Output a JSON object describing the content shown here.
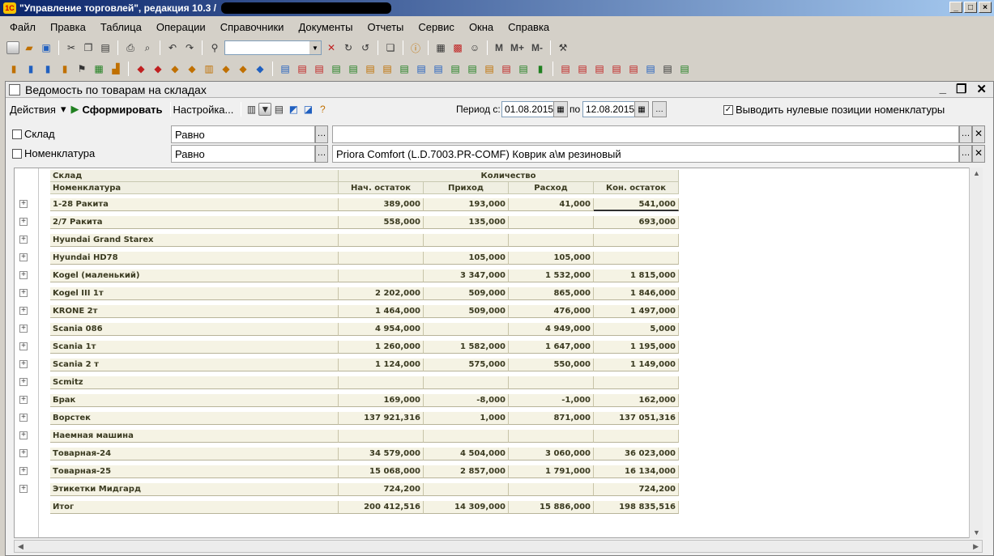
{
  "app": {
    "title": "\"Управление торговлей\", редакция 10.3 /",
    "logo": "1С"
  },
  "menu": [
    "Файл",
    "Правка",
    "Таблица",
    "Операции",
    "Справочники",
    "Документы",
    "Отчеты",
    "Сервис",
    "Окна",
    "Справка"
  ],
  "toolbar": {
    "m_label": "M",
    "mplus_label": "M+",
    "mminus_label": "M-"
  },
  "document": {
    "title": "Ведомость по товарам на складах",
    "actions_label": "Действия",
    "generate_label": "Сформировать",
    "settings_label": "Настройка...",
    "period_from_label": "Период с:",
    "period_from": "01.08.2015",
    "period_to_label": "по",
    "period_to": "12.08.2015",
    "zero_positions_label": "Выводить нулевые позиции номенклатуры",
    "zero_positions_checked": true
  },
  "filters": [
    {
      "label": "Склад",
      "checked": false,
      "comparison": "Равно",
      "value": ""
    },
    {
      "label": "Номенклатура",
      "checked": false,
      "comparison": "Равно",
      "value": "Priora Comfort (L.D.7003.PR-COMF) Коврик а\\м резиновый"
    }
  ],
  "report": {
    "header": {
      "col_sklad": "Склад",
      "col_nomen": "Номенклатура",
      "group_qty": "Количество",
      "col_start": "Нач. остаток",
      "col_in": "Приход",
      "col_out": "Расход",
      "col_end": "Кон. остаток"
    },
    "rows": [
      {
        "name": "1-28 Ракита",
        "start": "389,000",
        "in": "193,000",
        "out": "41,000",
        "end": "541,000"
      },
      {
        "name": "2/7 Ракита",
        "start": "558,000",
        "in": "135,000",
        "out": "",
        "end": "693,000"
      },
      {
        "name": "Hyundai Grand Starex",
        "start": "",
        "in": "",
        "out": "",
        "end": ""
      },
      {
        "name": "Hyundai HD78",
        "start": "",
        "in": "105,000",
        "out": "105,000",
        "end": ""
      },
      {
        "name": "Kogel (маленький)",
        "start": "",
        "in": "3 347,000",
        "out": "1 532,000",
        "end": "1 815,000"
      },
      {
        "name": "Kogel III  1т",
        "start": "2 202,000",
        "in": "509,000",
        "out": "865,000",
        "end": "1 846,000"
      },
      {
        "name": "KRONE 2т",
        "start": "1 464,000",
        "in": "509,000",
        "out": "476,000",
        "end": "1 497,000"
      },
      {
        "name": "Scania 086",
        "start": "4 954,000",
        "in": "",
        "out": "4 949,000",
        "end": "5,000"
      },
      {
        "name": "Scania 1т",
        "start": "1 260,000",
        "in": "1 582,000",
        "out": "1 647,000",
        "end": "1 195,000"
      },
      {
        "name": "Scania 2 т",
        "start": "1 124,000",
        "in": "575,000",
        "out": "550,000",
        "end": "1 149,000"
      },
      {
        "name": "Scmitz",
        "start": "",
        "in": "",
        "out": "",
        "end": ""
      },
      {
        "name": "Брак",
        "start": "169,000",
        "in": "-8,000",
        "out": "-1,000",
        "end": "162,000"
      },
      {
        "name": "Ворстек",
        "start": "137 921,316",
        "in": "1,000",
        "out": "871,000",
        "end": "137 051,316"
      },
      {
        "name": "Наемная машина",
        "start": "",
        "in": "",
        "out": "",
        "end": ""
      },
      {
        "name": "Товарная-24",
        "start": "34 579,000",
        "in": "4 504,000",
        "out": "3 060,000",
        "end": "36 023,000"
      },
      {
        "name": "Товарная-25",
        "start": "15 068,000",
        "in": "2 857,000",
        "out": "1 791,000",
        "end": "16 134,000"
      },
      {
        "name": "Этикетки Мидгард",
        "start": "724,200",
        "in": "",
        "out": "",
        "end": "724,200"
      }
    ],
    "total": {
      "name": "Итог",
      "start": "200 412,516",
      "in": "14 309,000",
      "out": "15 886,000",
      "end": "198 835,516"
    }
  }
}
